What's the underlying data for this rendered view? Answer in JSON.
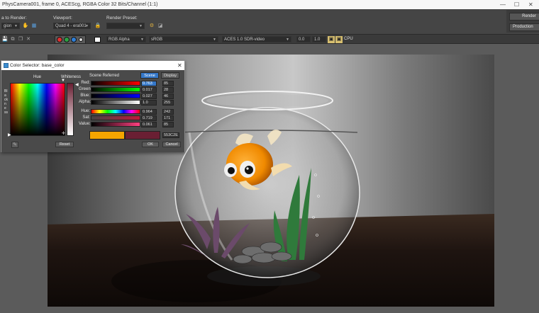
{
  "window": {
    "title": "PhysCamera001, frame 0, ACEScg, RGBA Color 32 Bits/Channel (1:1)",
    "controls": [
      "—",
      "☐",
      "✕"
    ]
  },
  "settings": {
    "area_label": "a to Render:",
    "area_value": "gion",
    "viewport_label": "Viewport:",
    "viewport_value": "Quad 4 - era001",
    "preset_label": "Render Preset:",
    "preset_value": "",
    "render_button": "Render",
    "production_value": "Production"
  },
  "toolbar": {
    "channel": "RGB Alpha",
    "colorspace": "sRGB",
    "view_transform": "ACES 1.0 SDR-video",
    "exposure": "0.0",
    "gamma": "1.0",
    "device": "CPU",
    "channel_colors": [
      "#e03030",
      "#2ea043",
      "#2f7fd8",
      "#f2f2f2"
    ]
  },
  "dialog": {
    "title": "Color Selector: base_color",
    "hue_label": "Hue",
    "whiteness_label": "Whiteness",
    "blackness_label": "Blackness",
    "scene_referred_label": "Scene Referred",
    "tab_scene": "Scene",
    "tab_display": "Display",
    "reset": "Reset",
    "ok": "OK",
    "cancel": "Cancel",
    "hex": "553C2E",
    "channels": [
      {
        "name": "Red:",
        "value": "0.763",
        "int": "85"
      },
      {
        "name": "Green:",
        "value": "0.017",
        "int": "28"
      },
      {
        "name": "Blue:",
        "value": "0.027",
        "int": "46"
      },
      {
        "name": "Alpha:",
        "value": "1.0",
        "int": "255"
      }
    ],
    "hsv": [
      {
        "name": "Hue:",
        "value": "0.964",
        "int": "242"
      },
      {
        "name": "Sat:",
        "value": "0.719",
        "int": "171"
      },
      {
        "name": "Value:",
        "value": "0.061",
        "int": "85"
      }
    ],
    "swatch_new": "#f5a500",
    "swatch_old": "#6a1f33"
  }
}
